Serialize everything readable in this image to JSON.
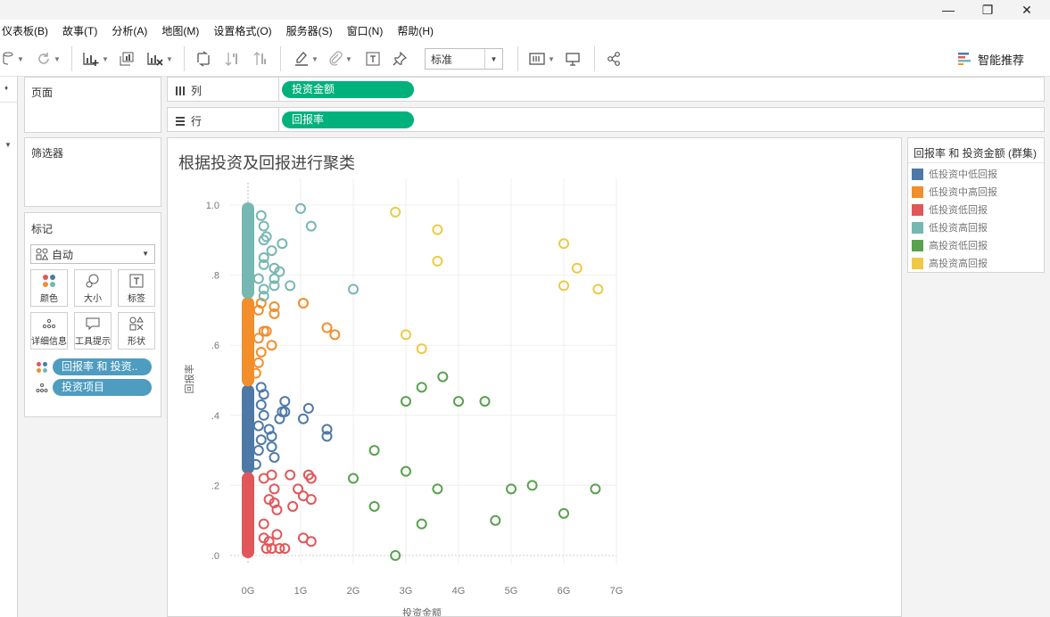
{
  "window": {
    "minimize_icon": "minimize-icon",
    "restore_icon": "restore-icon",
    "close_icon": "close-icon"
  },
  "menu": [
    "仪表板(B)",
    "故事(T)",
    "分析(A)",
    "地图(M)",
    "设置格式(O)",
    "服务器(S)",
    "窗口(N)",
    "帮助(H)"
  ],
  "toolbar": {
    "mark_type_value": "标准",
    "smart_recommend_label": "智能推荐"
  },
  "panels": {
    "pages_title": "页面",
    "filters_title": "筛选器",
    "marks_title": "标记",
    "marks_type": "自动"
  },
  "mark_buttons": {
    "color": "颜色",
    "size": "大小",
    "label": "标签",
    "detail": "详细信息",
    "tooltip": "工具提示",
    "shape": "形状"
  },
  "mark_pills": {
    "color_field": "回报率 和 投资..",
    "detail_field": "投资项目"
  },
  "shelves": {
    "columns_label": "列",
    "columns_field": "投资金额",
    "rows_label": "行",
    "rows_field": "回报率"
  },
  "legend": {
    "title": "回报率 和 投资金额 (群集)",
    "items": [
      {
        "label": "低投资中低回报",
        "color": "#4e79a7"
      },
      {
        "label": "低投资中高回报",
        "color": "#f28e2b"
      },
      {
        "label": "低投资低回报",
        "color": "#e15759"
      },
      {
        "label": "低投资高回报",
        "color": "#76b7b2"
      },
      {
        "label": "高投资低回报",
        "color": "#59a14f"
      },
      {
        "label": "高投资高回报",
        "color": "#edc948"
      }
    ]
  },
  "chart_data": {
    "type": "scatter",
    "title": "根据投资及回报进行聚类",
    "xlabel": "投资金额",
    "ylabel": "回报率",
    "xlim": [
      0,
      7
    ],
    "ylim": [
      0,
      1
    ],
    "x_ticks": [
      "0G",
      "1G",
      "2G",
      "3G",
      "4G",
      "5G",
      "6G",
      "7G"
    ],
    "y_ticks": [
      ".0",
      ".2",
      ".4",
      ".6",
      ".8",
      "1.0"
    ],
    "x_unit_note": "G",
    "series": [
      {
        "name": "低投资中低回报",
        "color": "#4e79a7",
        "dense_band": [
          0.24,
          0.48
        ],
        "points": [
          [
            0.25,
            0.48
          ],
          [
            0.3,
            0.46
          ],
          [
            0.25,
            0.43
          ],
          [
            0.7,
            0.44
          ],
          [
            0.65,
            0.41
          ],
          [
            0.7,
            0.41
          ],
          [
            0.6,
            0.39
          ],
          [
            1.15,
            0.42
          ],
          [
            1.05,
            0.39
          ],
          [
            1.5,
            0.36
          ],
          [
            1.5,
            0.34
          ],
          [
            0.3,
            0.4
          ],
          [
            0.2,
            0.37
          ],
          [
            0.45,
            0.34
          ],
          [
            0.45,
            0.31
          ],
          [
            0.25,
            0.33
          ],
          [
            0.5,
            0.28
          ],
          [
            0.2,
            0.3
          ],
          [
            0.15,
            0.26
          ],
          [
            0.4,
            0.36
          ]
        ]
      },
      {
        "name": "低投资中高回报",
        "color": "#f28e2b",
        "dense_band": [
          0.49,
          0.73
        ],
        "points": [
          [
            0.25,
            0.72
          ],
          [
            0.2,
            0.7
          ],
          [
            0.5,
            0.71
          ],
          [
            0.5,
            0.69
          ],
          [
            1.05,
            0.72
          ],
          [
            1.5,
            0.65
          ],
          [
            1.65,
            0.63
          ],
          [
            0.3,
            0.64
          ],
          [
            0.35,
            0.64
          ],
          [
            0.45,
            0.6
          ],
          [
            0.2,
            0.62
          ],
          [
            0.25,
            0.58
          ],
          [
            0.2,
            0.55
          ],
          [
            0.15,
            0.52
          ]
        ]
      },
      {
        "name": "低投资低回报",
        "color": "#e15759",
        "dense_band": [
          0.0,
          0.23
        ],
        "points": [
          [
            0.45,
            0.23
          ],
          [
            0.8,
            0.23
          ],
          [
            1.15,
            0.23
          ],
          [
            1.2,
            0.22
          ],
          [
            0.3,
            0.22
          ],
          [
            0.5,
            0.19
          ],
          [
            0.95,
            0.19
          ],
          [
            1.05,
            0.17
          ],
          [
            1.2,
            0.16
          ],
          [
            0.4,
            0.16
          ],
          [
            0.5,
            0.15
          ],
          [
            0.85,
            0.14
          ],
          [
            0.55,
            0.13
          ],
          [
            0.3,
            0.09
          ],
          [
            0.55,
            0.06
          ],
          [
            1.05,
            0.05
          ],
          [
            1.2,
            0.04
          ],
          [
            0.3,
            0.05
          ],
          [
            0.4,
            0.04
          ],
          [
            0.45,
            0.02
          ],
          [
            0.6,
            0.02
          ],
          [
            0.7,
            0.02
          ],
          [
            0.35,
            0.02
          ]
        ]
      },
      {
        "name": "低投资高回报",
        "color": "#76b7b2",
        "dense_band": [
          0.74,
          1.0
        ],
        "points": [
          [
            1.0,
            0.99
          ],
          [
            1.2,
            0.94
          ],
          [
            0.25,
            0.97
          ],
          [
            0.3,
            0.94
          ],
          [
            0.35,
            0.91
          ],
          [
            0.3,
            0.9
          ],
          [
            0.65,
            0.89
          ],
          [
            0.45,
            0.87
          ],
          [
            0.3,
            0.85
          ],
          [
            0.3,
            0.83
          ],
          [
            0.5,
            0.82
          ],
          [
            0.6,
            0.81
          ],
          [
            0.5,
            0.79
          ],
          [
            0.5,
            0.77
          ],
          [
            0.8,
            0.77
          ],
          [
            2.0,
            0.76
          ],
          [
            0.3,
            0.76
          ],
          [
            0.3,
            0.74
          ],
          [
            0.2,
            0.79
          ]
        ]
      },
      {
        "name": "高投资低回报",
        "color": "#59a14f",
        "points": [
          [
            3.7,
            0.51
          ],
          [
            3.3,
            0.48
          ],
          [
            3.0,
            0.44
          ],
          [
            4.0,
            0.44
          ],
          [
            4.5,
            0.44
          ],
          [
            2.4,
            0.3
          ],
          [
            3.0,
            0.24
          ],
          [
            2.0,
            0.22
          ],
          [
            3.6,
            0.19
          ],
          [
            5.0,
            0.19
          ],
          [
            5.4,
            0.2
          ],
          [
            6.6,
            0.19
          ],
          [
            2.4,
            0.14
          ],
          [
            6.0,
            0.12
          ],
          [
            4.7,
            0.1
          ],
          [
            3.3,
            0.09
          ],
          [
            2.8,
            0.0
          ]
        ]
      },
      {
        "name": "高投资高回报",
        "color": "#edc948",
        "points": [
          [
            2.8,
            0.98
          ],
          [
            3.6,
            0.93
          ],
          [
            6.0,
            0.89
          ],
          [
            3.6,
            0.84
          ],
          [
            6.25,
            0.82
          ],
          [
            6.0,
            0.77
          ],
          [
            6.65,
            0.76
          ],
          [
            3.0,
            0.63
          ],
          [
            3.3,
            0.59
          ]
        ]
      }
    ]
  }
}
